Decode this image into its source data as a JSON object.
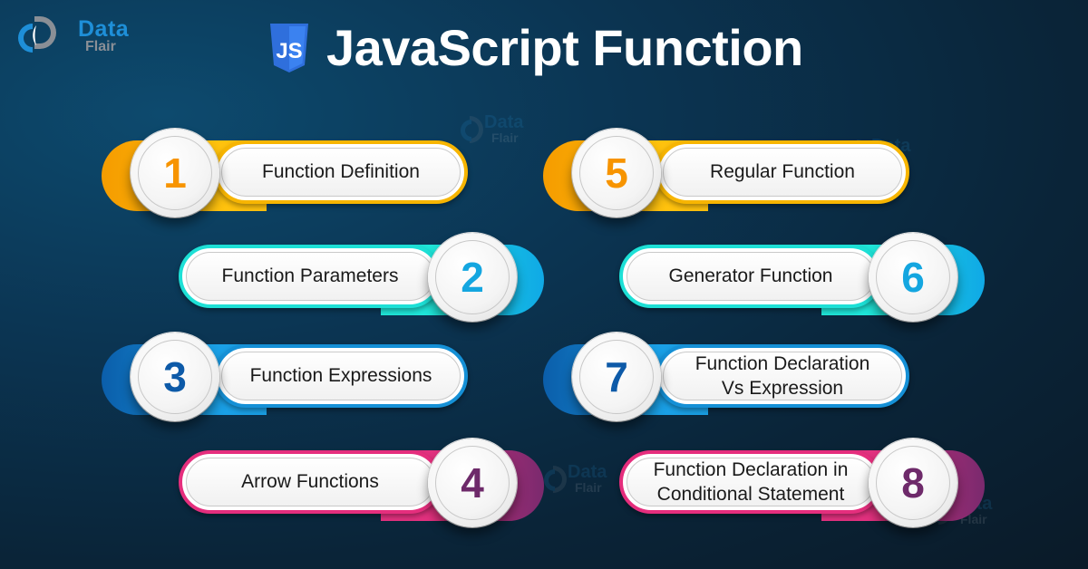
{
  "brand": {
    "name_line1": "Data",
    "name_line2": "Flair",
    "colors": {
      "blue": "#1e8fd8",
      "gray": "#8a8f96"
    }
  },
  "header": {
    "badge": "JS",
    "title": "JavaScript Function",
    "badge_color": "#2f6fdc"
  },
  "watermark": {
    "line1": "Data",
    "line2": "Flair"
  },
  "items": [
    {
      "number": "1",
      "label": "Function Definition",
      "theme": "yellow"
    },
    {
      "number": "2",
      "label": "Function Parameters",
      "theme": "cyan"
    },
    {
      "number": "3",
      "label": "Function Expressions",
      "theme": "blue"
    },
    {
      "number": "4",
      "label": "Arrow Functions",
      "theme": "magenta"
    },
    {
      "number": "5",
      "label": "Regular Function",
      "theme": "yellow"
    },
    {
      "number": "6",
      "label": "Generator Function",
      "theme": "cyan"
    },
    {
      "number": "7",
      "label": "Function Declaration Vs Expression",
      "label_line1": "Function Declaration",
      "label_line2": "Vs Expression",
      "theme": "blue"
    },
    {
      "number": "8",
      "label": "Function Declaration in Conditional Statement",
      "label_line1": "Function Declaration in",
      "label_line2": "Conditional Statement",
      "theme": "magenta"
    }
  ],
  "themes": {
    "yellow": {
      "border": "#f7b500",
      "collar": "#ffc20e",
      "blob": "#f59c00",
      "number": "#f79400"
    },
    "cyan": {
      "border": "#1de0d6",
      "collar": "#1fe6d9",
      "blob": "#10a9e6",
      "number": "#14a6e0"
    },
    "blue": {
      "border": "#1590d6",
      "collar": "#1aa0e6",
      "blob": "#0b5eaa",
      "number": "#0d5aa8"
    },
    "magenta": {
      "border": "#e52e7d",
      "collar": "#e3317f",
      "blob": "#7a2a6e",
      "number": "#6e2a6a"
    }
  }
}
